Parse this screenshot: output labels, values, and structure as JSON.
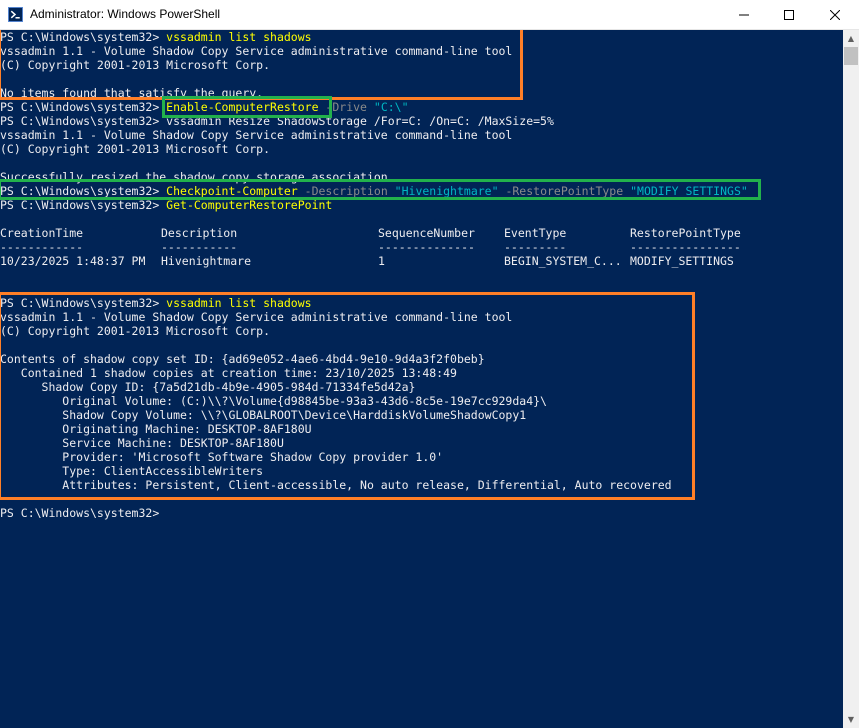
{
  "window": {
    "title": "Administrator: Windows PowerShell",
    "controls": {
      "minimize": "—",
      "maximize": "☐",
      "close": "✕"
    }
  },
  "colors": {
    "console_bg": "#012456",
    "text": "#eeedf0",
    "command": "#ffff00",
    "parameter": "#8a8a8a",
    "string": "#00b7c3",
    "highlight_orange": "#ff7f27",
    "highlight_green": "#22b14c"
  },
  "console": {
    "block1": {
      "l1_prompt": "PS C:\\Windows\\system32> ",
      "l1_cmd": "vssadmin list shadows",
      "l2": "vssadmin 1.1 - Volume Shadow Copy Service administrative command-line tool",
      "l3": "(C) Copyright 2001-2013 Microsoft Corp.",
      "l4": "",
      "l5": "No items found that satisfy the query."
    },
    "block2": {
      "l1_prompt": "PS C:\\Windows\\system32> ",
      "l1_cmd": "Enable-ComputerRestore",
      "l1_param": " -Drive ",
      "l1_str": "\"C:\\\"",
      "l2_prompt": "PS C:\\Windows\\system32> ",
      "l2_cmd": "vssadmin Resize ShadowStorage /For=C: /On=C: /MaxSize=5%",
      "l3": "vssadmin 1.1 - Volume Shadow Copy Service administrative command-line tool",
      "l4": "(C) Copyright 2001-2013 Microsoft Corp.",
      "l5": "",
      "l6": "Successfully resized the shadow copy storage association"
    },
    "block3": {
      "l1_prompt": "PS C:\\Windows\\system32> ",
      "l1_cmd": "Checkpoint-Computer",
      "l1_p1": " -Description ",
      "l1_s1": "\"Hivenightmare\"",
      "l1_p2": " -RestorePointType ",
      "l1_s2": "\"MODIFY_SETTINGS\"",
      "l2_prompt": "PS C:\\Windows\\system32> ",
      "l2_cmd": "Get-ComputerRestorePoint"
    },
    "restore_table": {
      "headers": [
        "CreationTime",
        "Description",
        "SequenceNumber",
        "EventType",
        "RestorePointType"
      ],
      "underlines": [
        "------------",
        "-----------",
        "--------------",
        "---------",
        "----------------"
      ],
      "rows": [
        [
          "10/23/2025 1:48:37 PM",
          "Hivenightmare",
          "1",
          "BEGIN_SYSTEM_C...",
          "MODIFY_SETTINGS"
        ]
      ]
    },
    "block4": {
      "l1_prompt": "PS C:\\Windows\\system32> ",
      "l1_cmd": "vssadmin list shadows",
      "l2": "vssadmin 1.1 - Volume Shadow Copy Service administrative command-line tool",
      "l3": "(C) Copyright 2001-2013 Microsoft Corp.",
      "l4": "",
      "l5": "Contents of shadow copy set ID: {ad69e052-4ae6-4bd4-9e10-9d4a3f2f0beb}",
      "l6": "   Contained 1 shadow copies at creation time: 23/10/2025 13:48:49",
      "l7": "      Shadow Copy ID: {7a5d21db-4b9e-4905-984d-71334fe5d42a}",
      "l8": "         Original Volume: (C:)\\\\?\\Volume{d98845be-93a3-43d6-8c5e-19e7cc929da4}\\",
      "l9": "         Shadow Copy Volume: \\\\?\\GLOBALROOT\\Device\\HarddiskVolumeShadowCopy1",
      "l10": "         Originating Machine: DESKTOP-8AF180U",
      "l11": "         Service Machine: DESKTOP-8AF180U",
      "l12": "         Provider: 'Microsoft Software Shadow Copy provider 1.0'",
      "l13": "         Type: ClientAccessibleWriters",
      "l14": "         Attributes: Persistent, Client-accessible, No auto release, Differential, Auto recovered"
    },
    "final_prompt": "PS C:\\Windows\\system32> "
  },
  "scrollbar": {
    "up": "▲",
    "down": "▼"
  }
}
